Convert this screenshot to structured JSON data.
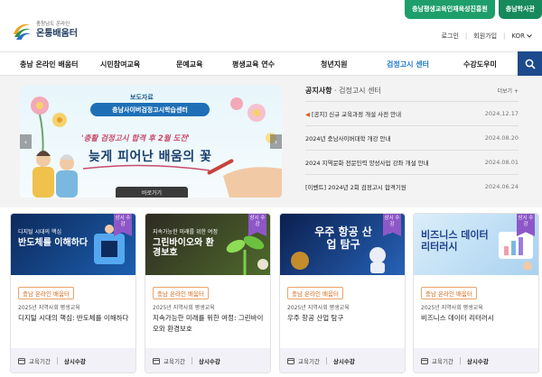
{
  "header": {
    "ext_buttons": [
      "충남평생교육인재육성진흥원",
      "충남학사관"
    ],
    "logo_sub": "충청남도 온라인",
    "logo_main": "온통배움터",
    "util": {
      "login": "로그인",
      "join": "회원가입",
      "lang": "KOR"
    }
  },
  "gnb": {
    "items": [
      "충남 온라인 배움터",
      "시민참여교육",
      "문예교육",
      "평생교육 연수",
      "청년지원",
      "검정고시 센터",
      "수강도우미"
    ],
    "active_index": 5
  },
  "banner": {
    "tag": "보도자료",
    "center": "충남사이버검정고시학습센터",
    "quote": "'충활 검정고시 합격 후 2월 도전'",
    "title": "늦게 피어난 배움의 꽃",
    "more": "바로가기"
  },
  "notice": {
    "title": "공지사항",
    "subtitle": "검정고시 센터",
    "more": "더보기 +",
    "rows": [
      {
        "text": "[공지] 신규 교육과정 개설 사전 안내",
        "date": "2024.12.17",
        "new": true
      },
      {
        "text": "2024년 충남사이버대학 개강 안내",
        "date": "2024.08.20",
        "new": false
      },
      {
        "text": "2024 지역문화 전문인력 양성사업 강좌 개설 안내",
        "date": "2024.08.01",
        "new": false
      },
      {
        "text": "[이벤트] 2024년 2회 검정고시 합격기원",
        "date": "2024.06.24",
        "new": false
      }
    ]
  },
  "cards": [
    {
      "img_small": "디지털 시대의 핵심",
      "img_main": "반도체를 이해하다",
      "badge": "상시 수강",
      "label": "충남 온라인 배움터",
      "year": "2025년 지역사회 평생교육",
      "title": "디지털 시대의 핵심: 반도체를 이해하다",
      "foot_k": "교육기간",
      "foot_v": "상시수강",
      "color1": "#0d2a5c",
      "color2": "#1c5fb0"
    },
    {
      "img_small": "지속가능한 미래를 위한 여정",
      "img_main": "그린바이오와 환경보호",
      "badge": "상시 수강",
      "label": "충남 온라인 배움터",
      "year": "2025년 지역사회 평생교육",
      "title": "지속가능한 미래를 위한 여정: 그린바이오와 환경보호",
      "foot_k": "교육기간",
      "foot_v": "상시수강",
      "color1": "#2e2a22",
      "color2": "#4f6b2c"
    },
    {
      "img_small": "",
      "img_main": "우주 항공 산업 탐구",
      "badge": "상시 수강",
      "label": "충남 온라인 배움터",
      "year": "2025년 지역사회 평생교육",
      "title": "우주 항공 산업 탐구",
      "foot_k": "교육기간",
      "foot_v": "상시수강",
      "color1": "#0b1f4e",
      "color2": "#2763b8"
    },
    {
      "img_small": "",
      "img_main": "비즈니스 데이터 리터러시",
      "badge": "상시 수강",
      "label": "충남 온라인 배움터",
      "year": "2025년 지역사회 평생교육",
      "title": "비즈니스 데이터 리터러시",
      "foot_k": "교육기간",
      "foot_v": "상시수강",
      "color1": "#cfe6f7",
      "color2": "#a8d1f0"
    }
  ]
}
